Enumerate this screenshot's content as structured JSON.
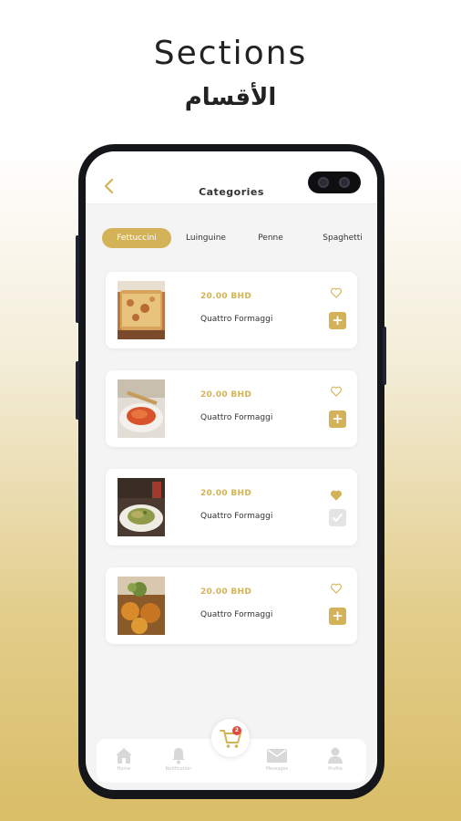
{
  "promo": {
    "title": "Sections",
    "subtitle": "الأقسام"
  },
  "header": {
    "title": "Categories",
    "back_icon": "chevron-left-icon"
  },
  "tabs": [
    {
      "label": "Fettuccini",
      "active": true
    },
    {
      "label": "Luinguine",
      "active": false
    },
    {
      "label": "Penne",
      "active": false
    },
    {
      "label": "Spaghetti",
      "active": false
    }
  ],
  "items": [
    {
      "price": "20.00 BHD",
      "name": "Quattro Formaggi",
      "favorited": false,
      "in_cart": false,
      "image": "lasagna-photo"
    },
    {
      "price": "20.00 BHD",
      "name": "Quattro Formaggi",
      "favorited": false,
      "in_cart": false,
      "image": "spaghetti-photo"
    },
    {
      "price": "20.00 BHD",
      "name": "Quattro Formaggi",
      "favorited": true,
      "in_cart": true,
      "image": "pesto-pasta-photo"
    },
    {
      "price": "20.00 BHD",
      "name": "Quattro Formaggi",
      "favorited": false,
      "in_cart": false,
      "image": "fried-dish-photo"
    }
  ],
  "cart": {
    "count": "2",
    "icon": "cart-icon"
  },
  "bottom_nav": [
    {
      "label": "Home",
      "icon": "home-icon"
    },
    {
      "label": "Notification",
      "icon": "bell-icon"
    },
    {
      "label": "Messages",
      "icon": "envelope-icon"
    },
    {
      "label": "Profile",
      "icon": "person-icon"
    }
  ],
  "colors": {
    "accent": "#d4b257",
    "badge": "#e2493b",
    "phone_frame": "#15161a"
  }
}
